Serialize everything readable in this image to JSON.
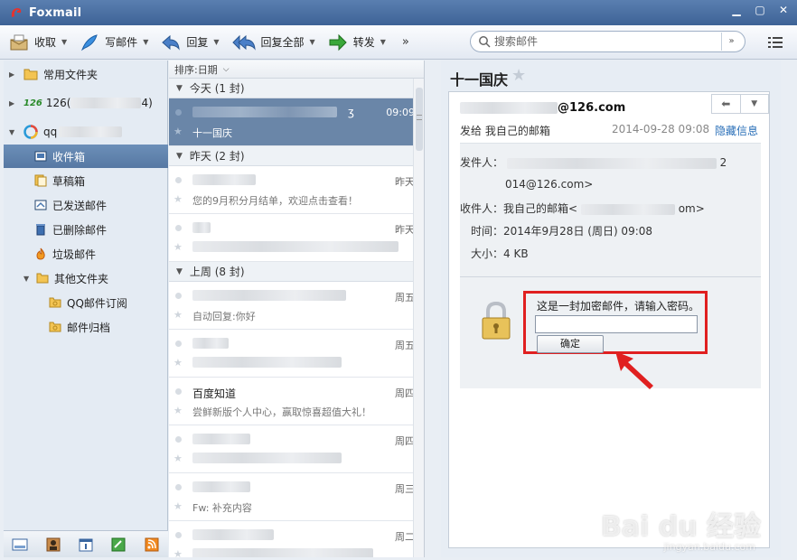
{
  "window": {
    "title": "Foxmail"
  },
  "toolbar": {
    "receive": "收取",
    "compose": "写邮件",
    "reply": "回复",
    "reply_all": "回复全部",
    "forward": "转发",
    "more": "»",
    "search_placeholder": "搜索邮件"
  },
  "sidebar": {
    "common_folder": "常用文件夹",
    "account_126": "126(",
    "account_126_suffix": "4)",
    "account_qq": "qq",
    "items": [
      {
        "label": "收件箱",
        "icon": "inbox-icon"
      },
      {
        "label": "草稿箱",
        "icon": "drafts-icon"
      },
      {
        "label": "已发送邮件",
        "icon": "sent-icon"
      },
      {
        "label": "已删除邮件",
        "icon": "trash-icon"
      },
      {
        "label": "垃圾邮件",
        "icon": "spam-icon"
      },
      {
        "label": "其他文件夹",
        "icon": "folder-icon"
      },
      {
        "label": "QQ邮件订阅",
        "icon": "subscribe-folder-icon"
      },
      {
        "label": "邮件归档",
        "icon": "archive-folder-icon"
      }
    ]
  },
  "list": {
    "sort_label": "排序:日期",
    "groups": {
      "today": "今天 (1 封)",
      "yesterday": "昨天 (2 封)",
      "last_week": "上周 (8 封)"
    },
    "mails": [
      {
        "subject": "",
        "preview": "十一国庆",
        "time": "09:09"
      },
      {
        "subject": "",
        "preview": "您的9月积分月结单，欢迎点击查看！",
        "time": "昨天"
      },
      {
        "subject": "",
        "preview": "",
        "time": "昨天"
      },
      {
        "subject": "",
        "preview": "自动回复:你好",
        "time": "周五"
      },
      {
        "subject": "",
        "preview": "",
        "time": "周五"
      },
      {
        "subject": "百度知道",
        "preview": "尝鲜新版个人中心，赢取惊喜超值大礼！",
        "time": "周四"
      },
      {
        "subject": "",
        "preview": "",
        "time": "周四"
      },
      {
        "subject": "",
        "preview": "Fw: 补充内容",
        "time": "周三"
      },
      {
        "subject": "",
        "preview": "",
        "time": "周二"
      }
    ]
  },
  "reader": {
    "subject": "十一国庆",
    "from_suffix": "@126.com",
    "to_line": "发给 我自己的邮箱",
    "date": "2014-09-28 09:08",
    "hide_info": "隐藏信息",
    "sender_label": "发件人：",
    "sender_tail": "2",
    "sender_line2": "014@126.com>",
    "recipient_label": "收件人：我自己的邮箱<",
    "recipient_tail": "om>",
    "time_line": "时间：2014年9月28日 (周日) 09:08",
    "size_line": "大小：4 KB",
    "encrypted_tip": "这是一封加密邮件，请输入密码。",
    "ok_button": "确定"
  },
  "watermark": {
    "text": "Bai du 经验",
    "sub": "jingyan.baidu.com"
  }
}
